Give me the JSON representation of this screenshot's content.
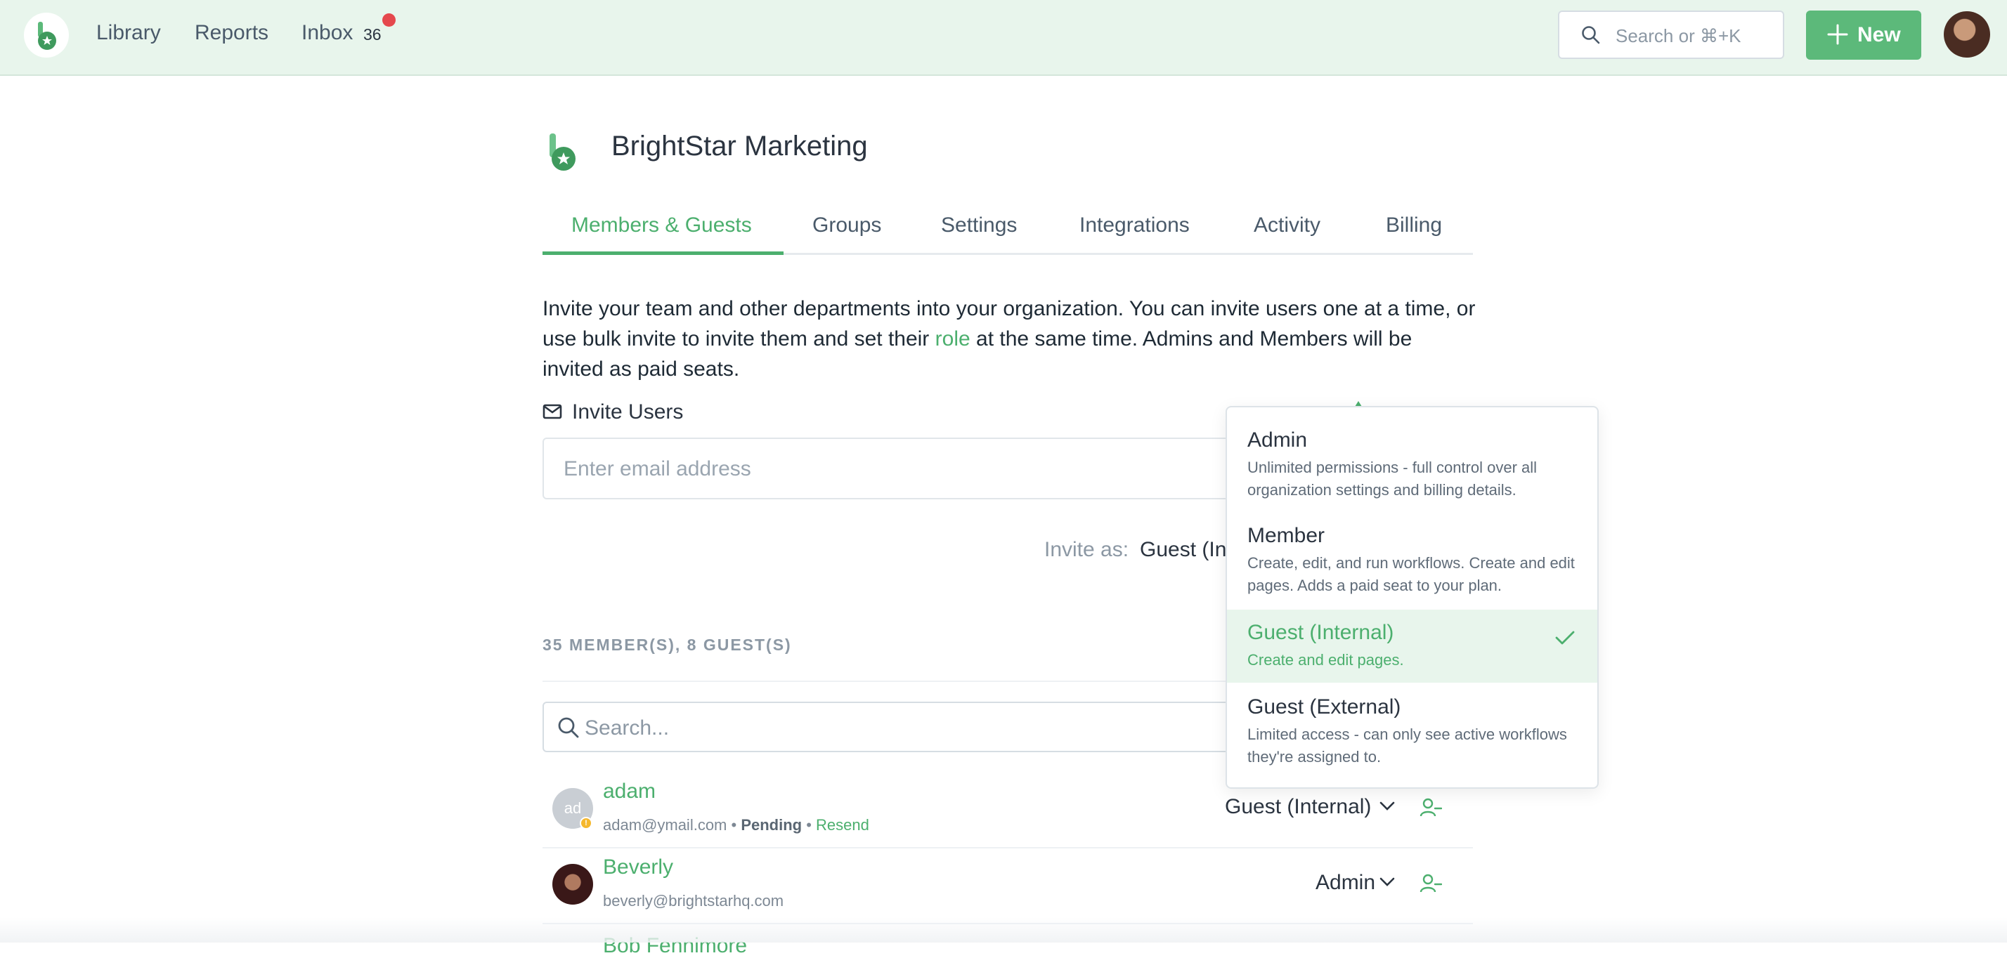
{
  "topbar": {
    "nav": [
      "Library",
      "Reports",
      "Inbox"
    ],
    "inbox_count": "36",
    "search_placeholder": "Search or ⌘+K",
    "new_label": "New"
  },
  "org": {
    "name": "BrightStar Marketing"
  },
  "tabs": [
    "Members & Guests",
    "Groups",
    "Settings",
    "Integrations",
    "Activity",
    "Billing"
  ],
  "active_tab": "Members & Guests",
  "intro": {
    "part1": "Invite your team and other departments into your organization. You can invite users one at a time, or use bulk invite to invite them and set their ",
    "link": "role",
    "part2": " at the same time. Admins and Members will be invited as paid seats."
  },
  "invite": {
    "heading": "Invite Users",
    "email_placeholder": "Enter email address",
    "invite_as_label": "Invite as:",
    "invite_as_value": "Guest (In"
  },
  "members": {
    "count_label": "35 MEMBER(S), 8 GUEST(S)",
    "search_placeholder": "Search...",
    "rows": [
      {
        "initials": "ad",
        "name": "adam",
        "email": "adam@ymail.com",
        "status": "Pending",
        "action": "Resend",
        "role": "Guest (Internal)"
      },
      {
        "name": "Beverly",
        "email": "beverly@brightstarhq.com",
        "role": "Admin"
      },
      {
        "name": "Bob Fennimore"
      }
    ]
  },
  "role_dropdown": {
    "selected": "Guest (Internal)",
    "options": [
      {
        "title": "Admin",
        "desc": "Unlimited permissions - full control over all organization settings and billing details."
      },
      {
        "title": "Member",
        "desc": "Create, edit, and run workflows. Create and edit pages. Adds a paid seat to your plan."
      },
      {
        "title": "Guest (Internal)",
        "desc": "Create and edit pages."
      },
      {
        "title": "Guest (External)",
        "desc": "Limited access - can only see active workflows they're assigned to."
      }
    ]
  },
  "colors": {
    "brand": "#4caf6e",
    "topbar_bg": "#e8f5ec",
    "badge_red": "#e5484d"
  },
  "icons": [
    "brand-logo-icon",
    "search-icon",
    "plus-icon",
    "envelope-icon",
    "chevron-down-icon",
    "remove-user-icon",
    "check-icon"
  ]
}
